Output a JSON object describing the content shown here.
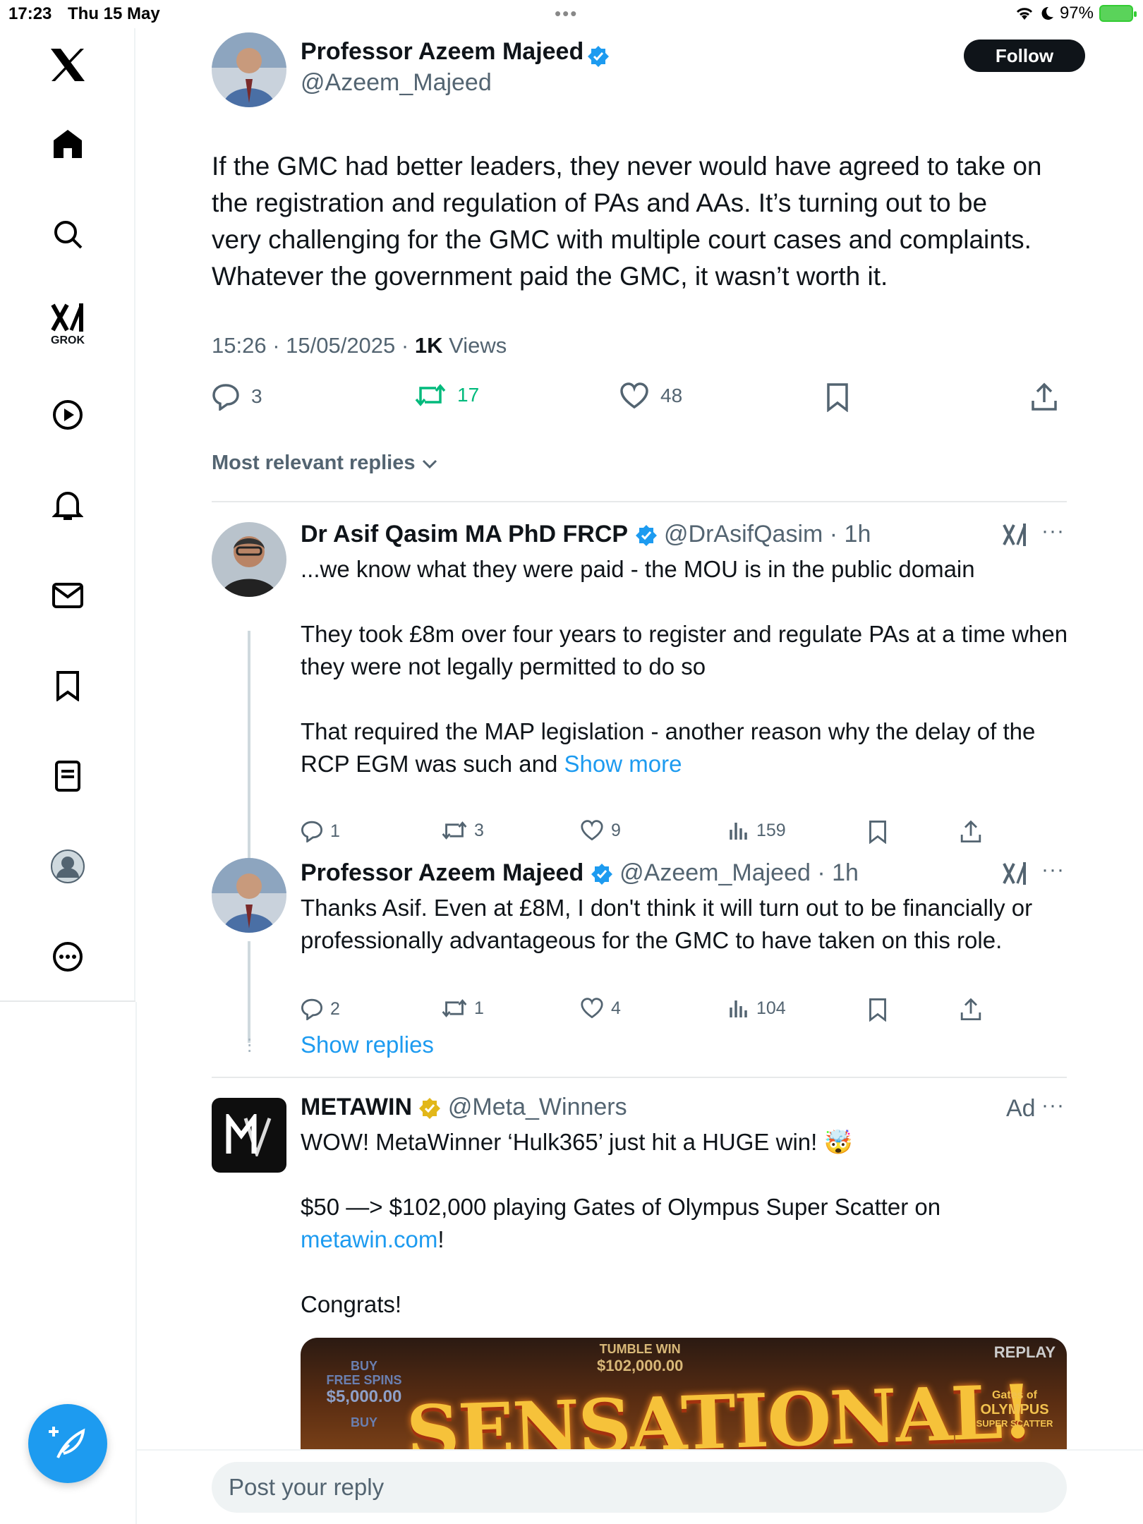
{
  "status_bar": {
    "time": "17:23",
    "date": "Thu 15 May",
    "battery": "97%"
  },
  "sidebar": {
    "grok_label": "GROK",
    "compose_icon": "feather-plus-icon"
  },
  "tweet": {
    "author_name": "Professor Azeem Majeed",
    "author_handle": "@Azeem_Majeed",
    "follow_label": "Follow",
    "text_lines": [
      "If the GMC had better leaders, they never would have agreed to take on",
      "the registration and regulation of PAs and AAs. It’s turning out to be",
      "very challenging for the GMC with multiple court cases and complaints.",
      "Whatever the government paid the GMC, it wasn’t worth it."
    ],
    "timestamp": "15:26 · 15/05/2025 · ",
    "views_count": "1K",
    "views_label": " Views",
    "replies": "3",
    "reposts": "17",
    "likes": "48"
  },
  "sort_label": "Most relevant replies",
  "replies": [
    {
      "name": "Dr Asif Qasim MA PhD FRCP",
      "handle": "@DrAsifQasim",
      "time": " · 1h",
      "paragraphs": [
        "...we know what they were paid - the MOU is in the public domain",
        "They took £8m over four years to register and regulate PAs at a time when they were not legally permitted to do so",
        "That required the MAP legislation - another reason why the delay of the RCP EGM was such and "
      ],
      "show_more": "Show more",
      "replies": "1",
      "reposts": "3",
      "likes": "9",
      "views": "159"
    },
    {
      "name": "Professor Azeem Majeed",
      "handle": "@Azeem_Majeed",
      "time": " · 1h",
      "paragraphs": [
        "Thanks Asif. Even at £8M, I don't think it will turn out to be financially or professionally advantageous for the GMC to have taken on this role."
      ],
      "replies": "2",
      "reposts": "1",
      "likes": "4",
      "views": "104"
    }
  ],
  "show_replies": "Show replies",
  "ad": {
    "name": "METAWIN",
    "handle": "@Meta_Winners",
    "ad_label": "Ad",
    "line1": "WOW! MetaWinner ‘Hulk365’ just hit a HUGE win! 🤯",
    "line2": "$50 —> $102,000 playing Gates of Olympus Super Scatter on ",
    "link": "metawin.com",
    "line2_end": "!",
    "line3": "Congrats!",
    "image_text": "SENSATIONAL!",
    "image_replay": "REPLAY",
    "image_buy1": "BUY",
    "image_freespins": "FREE SPINS",
    "image_price": "$5,000.00",
    "image_buy2": "BUY",
    "image_tumble": "TUMBLE WIN",
    "image_tumble_amount": "$102,000.00",
    "image_gates": "Gates of",
    "image_olympus": "OLYMPUS",
    "image_superscatter": "SUPER SCATTER"
  },
  "reply_placeholder": "Post your reply",
  "colors": {
    "accent": "#1d9bf0",
    "repost_green": "#00ba7c",
    "text": "#0f1419",
    "secondary": "#536471"
  }
}
